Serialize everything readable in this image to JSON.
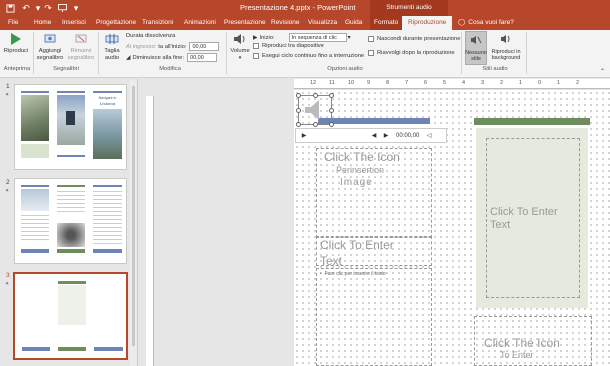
{
  "titlebar": {
    "doc_title": "Presentazione 4.pptx  -  PowerPoint",
    "context_title": "Strumenti audio",
    "qat": [
      "save-icon",
      "undo-icon",
      "redo-icon",
      "presenter-icon",
      "qat-more-icon"
    ]
  },
  "tabs": [
    {
      "label": "File"
    },
    {
      "label": "Home"
    },
    {
      "label": "Inserisci"
    },
    {
      "label": "Progettazione"
    },
    {
      "label": "Transizioni"
    },
    {
      "label": "Animazioni"
    },
    {
      "label": "Presentazione"
    },
    {
      "label": "Revisione"
    },
    {
      "label": "Visualizza"
    },
    {
      "label": "Guida"
    },
    {
      "label": "Formato"
    },
    {
      "label": "Riproduzione"
    }
  ],
  "tell_me": "Cosa vuoi fare?",
  "ribbon": {
    "play": {
      "label": "Riproduci",
      "group": "Anteprima"
    },
    "bookmarks": {
      "add": "Aggiungi segnalibro",
      "remove": "Rimuovi segnalibro",
      "group": "Segnalibri"
    },
    "trim": {
      "label": "Taglia audio"
    },
    "edit": {
      "fade_title": "Durata dissolvenza",
      "fade_in_label": "Al ingresso:",
      "fade_in_label2": "ta all'inizio:",
      "fade_in_value": "00,00",
      "fade_out_label": "Diminuisce alla fine:",
      "fade_out_value": "00,00",
      "group": "Modifica"
    },
    "volume": {
      "label": "Volume"
    },
    "audio_options": {
      "start_label": "Inizio:",
      "start_value": "In sequenza di clic",
      "across_slides": "Riproduci tra diapositive",
      "loop": "Esegui ciclo continuo fino a interruzione",
      "hide": "Nascondi durante presentazione",
      "rewind": "Riavvolgi dopo la riproduzione",
      "group": "Opzioni audio"
    },
    "styles": {
      "no_style": "Nessuno stile",
      "background": "Riproduci in background",
      "group": "Stili audio"
    }
  },
  "slides": [
    {
      "number": "1"
    },
    {
      "number": "2"
    },
    {
      "number": "3"
    }
  ],
  "thumb1": {
    "title_line1": "Navigare in",
    "title_line2": "Lisbona"
  },
  "rulers": {
    "h_ticks": [
      "12",
      "11",
      "10",
      "9",
      "8",
      "7",
      "6",
      "5",
      "4",
      "3",
      "2",
      "1",
      "0",
      "1",
      "2"
    ]
  },
  "player": {
    "time": "00:00,00"
  },
  "slide": {
    "left_picture_placeholder": "Click The Icon",
    "left_picture_placeholder2": "Perinsertion",
    "left_picture_placeholder3": "Image",
    "left_text_placeholder": "Click To Enter",
    "left_text_placeholder2": "Text",
    "bullet_hint": "Fare clic per inserire il testo",
    "right_text_placeholder": "Click To Enter",
    "right_text_placeholder2": "Text",
    "right_picture_placeholder": "Click The Icon",
    "right_picture_placeholder2": "To Enter"
  },
  "colors": {
    "accent": "#b7472a",
    "green": "#6e8c5e",
    "blue": "#6d84b4"
  }
}
